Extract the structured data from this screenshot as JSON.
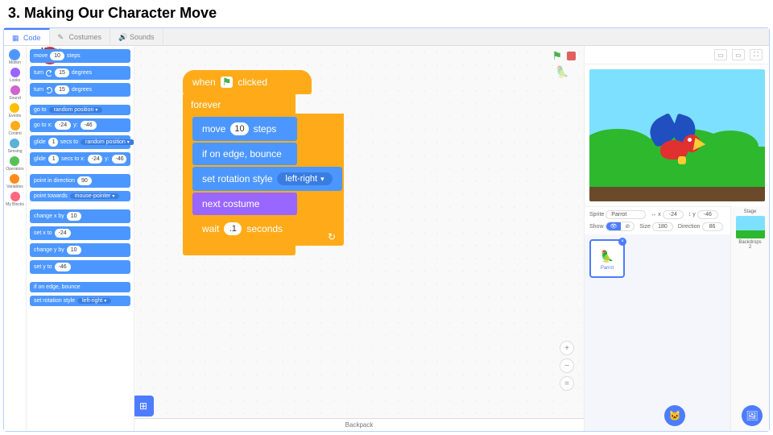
{
  "title": "3. Making Our Character Move",
  "tabs": {
    "code": "Code",
    "costumes": "Costumes",
    "sounds": "Sounds",
    "active": "code"
  },
  "categories": [
    {
      "name": "Motion",
      "color": "#4c97ff"
    },
    {
      "name": "Looks",
      "color": "#9966ff"
    },
    {
      "name": "Sound",
      "color": "#cf63cf"
    },
    {
      "name": "Events",
      "color": "#ffbf00"
    },
    {
      "name": "Control",
      "color": "#ffab19"
    },
    {
      "name": "Sensing",
      "color": "#5cb1d6"
    },
    {
      "name": "Operators",
      "color": "#59c059"
    },
    {
      "name": "Variables",
      "color": "#ff8c1a"
    },
    {
      "name": "My Blocks",
      "color": "#ff6680"
    }
  ],
  "palette_header": "Motion",
  "palette_blocks": {
    "move": {
      "pre": "move",
      "val": "10",
      "post": "steps"
    },
    "turn_cw": {
      "pre": "turn",
      "val": "15",
      "post": "degrees"
    },
    "turn_ccw": {
      "pre": "turn",
      "val": "15",
      "post": "degrees"
    },
    "goto": {
      "pre": "go to",
      "dd": "random position"
    },
    "goto_xy": {
      "pre": "go to x:",
      "x": "-24",
      "mid": "y:",
      "y": "-46"
    },
    "glide": {
      "pre": "glide",
      "sec": "1",
      "mid": "secs to",
      "dd": "random position"
    },
    "glide_xy": {
      "pre": "glide",
      "sec": "1",
      "mid": "secs to x:",
      "x": "-24",
      "mid2": "y:",
      "y": "-46"
    },
    "point_dir": {
      "pre": "point in direction",
      "val": "90"
    },
    "point_towards": {
      "pre": "point towards",
      "dd": "mouse-pointer"
    },
    "change_x": {
      "pre": "change x by",
      "val": "10"
    },
    "set_x": {
      "pre": "set x to",
      "val": "-24"
    },
    "change_y": {
      "pre": "change y by",
      "val": "10"
    },
    "set_y": {
      "pre": "set y to",
      "val": "-46"
    },
    "edge": "if on edge, bounce",
    "rot_style": {
      "pre": "set rotation style",
      "dd": "left-right"
    }
  },
  "script": {
    "hat": {
      "pre": "when",
      "post": "clicked"
    },
    "forever": "forever",
    "b1": {
      "pre": "move",
      "val": "10",
      "post": "steps"
    },
    "b2": "if on edge, bounce",
    "b3": {
      "pre": "set rotation style",
      "dd": "left-right"
    },
    "b4": "next costume",
    "b5": {
      "pre": "wait",
      "val": ".1",
      "post": "seconds"
    }
  },
  "sprite_info": {
    "label_sprite": "Sprite",
    "name": "Parrot",
    "x_label": "x",
    "x": "-24",
    "y_label": "y",
    "y": "-46",
    "show_label": "Show",
    "size_label": "Size",
    "size": "180",
    "dir_label": "Direction",
    "dir": "86"
  },
  "sprite_card": {
    "name": "Parrot"
  },
  "stage_panel": {
    "title": "Stage",
    "backdrops_label": "Backdrops",
    "backdrops_count": "2"
  },
  "backpack": "Backpack",
  "stage_controls": {
    "small": "▭",
    "large": "▭",
    "full": "⛶"
  }
}
